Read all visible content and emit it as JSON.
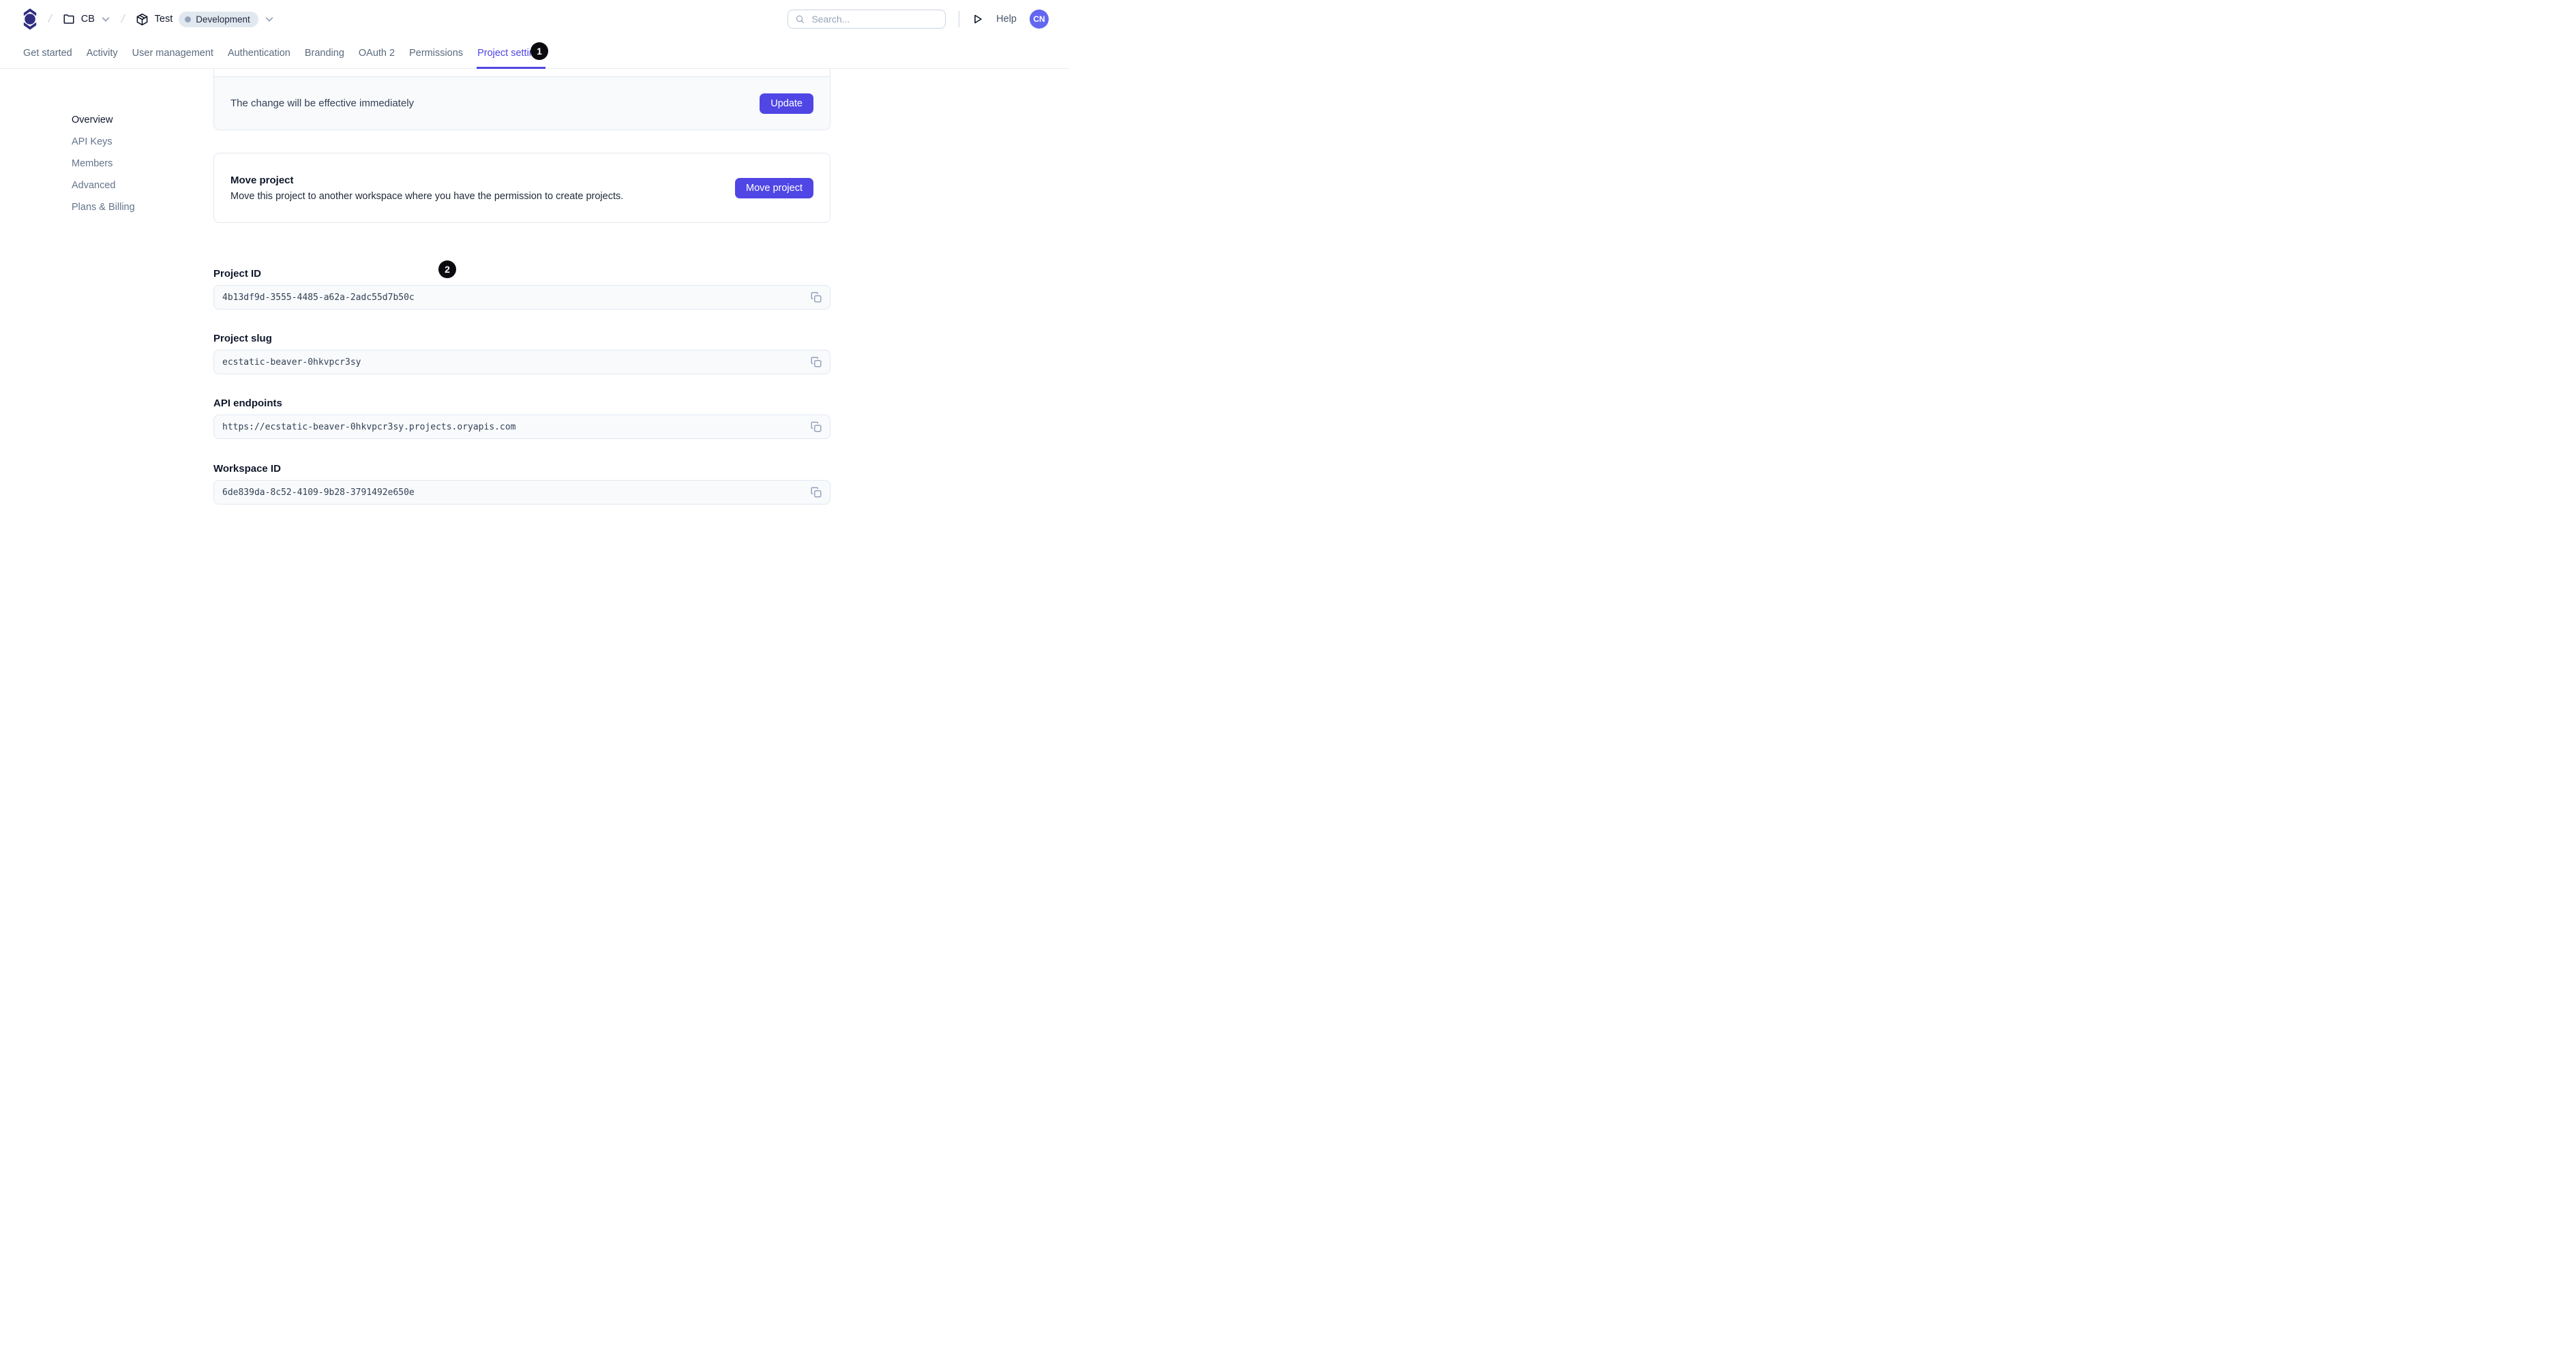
{
  "header": {
    "breadcrumb": {
      "separator": "/",
      "workspace": {
        "label": "CB"
      },
      "project": {
        "label": "Test",
        "environment": "Development"
      }
    },
    "search": {
      "placeholder": "Search..."
    },
    "help_label": "Help",
    "avatar_initials": "CN"
  },
  "tabs": {
    "items": [
      {
        "label": "Get started",
        "active": false
      },
      {
        "label": "Activity",
        "active": false
      },
      {
        "label": "User management",
        "active": false
      },
      {
        "label": "Authentication",
        "active": false
      },
      {
        "label": "Branding",
        "active": false
      },
      {
        "label": "OAuth 2",
        "active": false
      },
      {
        "label": "Permissions",
        "active": false
      },
      {
        "label": "Project settings",
        "active": true
      }
    ]
  },
  "sidebar": {
    "items": [
      {
        "label": "Overview",
        "active": true
      },
      {
        "label": "API Keys",
        "active": false
      },
      {
        "label": "Members",
        "active": false
      },
      {
        "label": "Advanced",
        "active": false
      },
      {
        "label": "Plans & Billing",
        "active": false
      }
    ]
  },
  "main": {
    "update_card": {
      "message": "The change will be effective immediately",
      "button_label": "Update"
    },
    "move_card": {
      "title": "Move project",
      "description": "Move this project to another workspace where you have the permission to create projects.",
      "button_label": "Move project"
    },
    "fields": [
      {
        "label": "Project ID",
        "value": "4b13df9d-3555-4485-a62a-2adc55d7b50c"
      },
      {
        "label": "Project slug",
        "value": "ecstatic-beaver-0hkvpcr3sy"
      },
      {
        "label": "API endpoints",
        "value": "https://ecstatic-beaver-0hkvpcr3sy.projects.oryapis.com"
      },
      {
        "label": "Workspace ID",
        "value": "6de839da-8c52-4109-9b28-3791492e650e"
      }
    ]
  },
  "annotations": [
    {
      "label": "1"
    },
    {
      "label": "2"
    }
  ],
  "colors": {
    "accent": "#4f46e5",
    "active_tab": "#4f46e5",
    "avatar_bg": "#6366f1",
    "logo": "#312e81",
    "env_badge_bg": "#e2e8f0",
    "env_badge_dot": "#94a3b8",
    "border": "#e2e8f0",
    "field_bg": "#f8fafc",
    "muted_text": "#64748b",
    "dark_text": "#0f172a",
    "annotation_bg": "#0b0b0f"
  }
}
